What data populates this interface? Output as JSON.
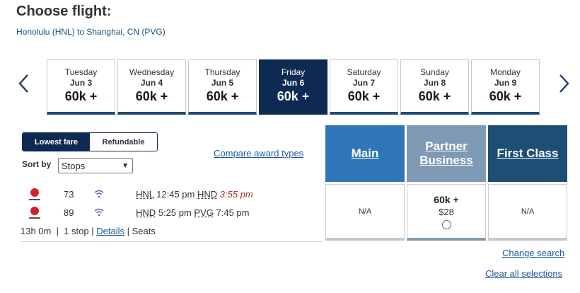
{
  "page": {
    "title": "Choose flight:",
    "route": "Honolulu (HNL) to Shanghai, CN (PVG)"
  },
  "dates": [
    {
      "dow": "Tuesday",
      "md": "Jun 3",
      "pts": "60k +"
    },
    {
      "dow": "Wednesday",
      "md": "Jun 4",
      "pts": "60k +"
    },
    {
      "dow": "Thursday",
      "md": "Jun 5",
      "pts": "60k +"
    },
    {
      "dow": "Friday",
      "md": "Jun 6",
      "pts": "60k +",
      "selected": true
    },
    {
      "dow": "Saturday",
      "md": "Jun 7",
      "pts": "60k +"
    },
    {
      "dow": "Sunday",
      "md": "Jun 8",
      "pts": "60k +"
    },
    {
      "dow": "Monday",
      "md": "Jun 9",
      "pts": "60k +"
    }
  ],
  "filters": {
    "lowest": "Lowest fare",
    "refundable": "Refundable",
    "sort_label": "Sort by",
    "sort_value": "Stops"
  },
  "compare": "Compare award types",
  "fare_types": {
    "main": "Main",
    "partner": "Partner Business",
    "first": "First Class"
  },
  "fares": {
    "main": "N/A",
    "partner_pts": "60k +",
    "partner_cash": "$28",
    "first": "N/A"
  },
  "flights": [
    {
      "num": "73",
      "from": "HNL",
      "dep": "12:45 pm",
      "to": "HND",
      "arr": "3:55 pm"
    },
    {
      "num": "89",
      "from": "HND",
      "dep": "5:25 pm",
      "to": "PVG",
      "arr": "7:45 pm"
    }
  ],
  "summary": {
    "duration": "13h 0m",
    "stops": "1 stop",
    "details": "Details",
    "seats": "Seats"
  },
  "links": {
    "change": "Change search",
    "clear": "Clear all selections"
  },
  "colors": {
    "navy": "#0d2b52",
    "main": "#2e76b7",
    "partner": "#7f9ab4",
    "first": "#1d4f74",
    "link": "#1d5a96",
    "airline_red": "#d1202f"
  },
  "icons": {
    "prev": "chevron-left-icon",
    "next": "chevron-right-icon",
    "wifi": "wifi-icon",
    "airline": "airline-logo-icon"
  }
}
